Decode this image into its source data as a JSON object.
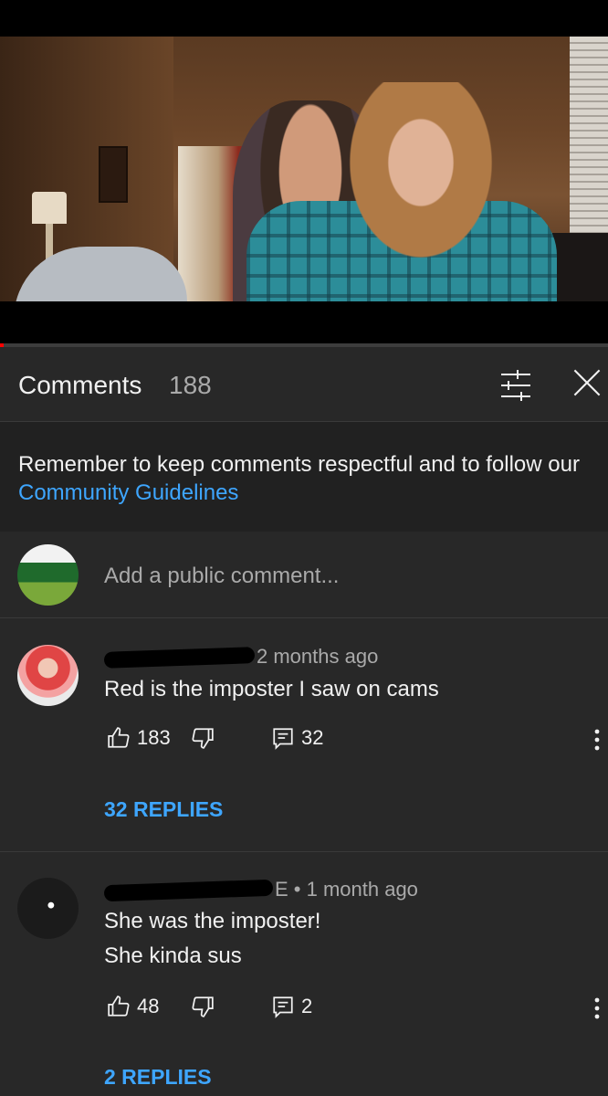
{
  "video": {
    "description_icon": "video-frame"
  },
  "comments_panel": {
    "title": "Comments",
    "count": "188",
    "sort_icon": "sort-filter-icon",
    "close_icon": "close-icon"
  },
  "notice": {
    "text": "Remember to keep comments respectful and to follow our ",
    "link": "Community Guidelines"
  },
  "add_comment": {
    "placeholder": "Add a public comment..."
  },
  "comments": [
    {
      "meta_suffix": "2 months ago",
      "lines": [
        "Red is the imposter I saw on cams"
      ],
      "likes": "183",
      "reply_count": "32",
      "replies_label": "32 REPLIES"
    },
    {
      "meta_suffix": "E • 1 month ago",
      "lines": [
        "She was the imposter!",
        "She kinda sus"
      ],
      "likes": "48",
      "reply_count": "2",
      "replies_label": "2 REPLIES"
    }
  ],
  "colors": {
    "background": "#282828",
    "notice_bg": "#212121",
    "link": "#3ea6ff",
    "secondary_text": "#aaaaaa",
    "progress": "#ff0000"
  }
}
